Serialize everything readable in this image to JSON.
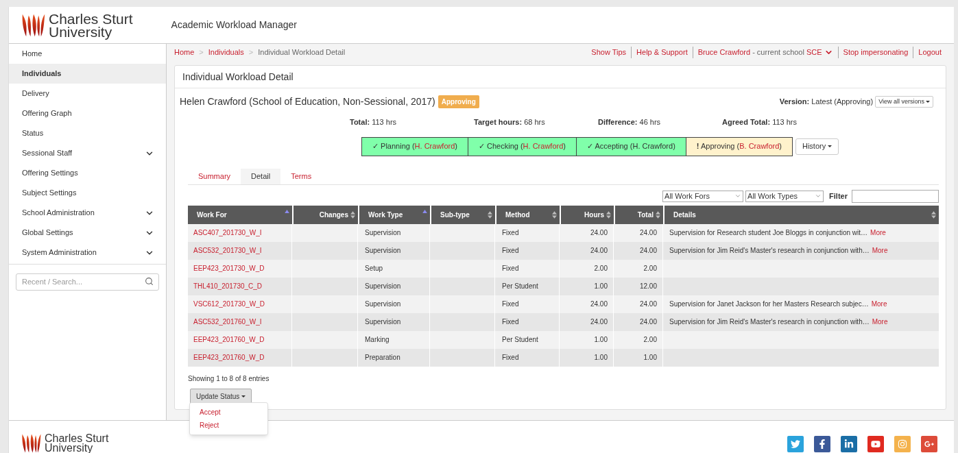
{
  "header": {
    "logo_lines": [
      "Charles Sturt",
      "University"
    ],
    "app_title": "Academic Workload Manager"
  },
  "sidebar": {
    "items": [
      {
        "label": "Home",
        "selected": false,
        "expandable": false
      },
      {
        "label": "Individuals",
        "selected": true,
        "expandable": false
      },
      {
        "label": "Delivery",
        "selected": false,
        "expandable": false
      },
      {
        "label": "Offering Graph",
        "selected": false,
        "expandable": false
      },
      {
        "label": "Status",
        "selected": false,
        "expandable": false
      },
      {
        "label": "Sessional Staff",
        "selected": false,
        "expandable": true
      },
      {
        "label": "Offering Settings",
        "selected": false,
        "expandable": false
      },
      {
        "label": "Subject Settings",
        "selected": false,
        "expandable": false
      },
      {
        "label": "School Administration",
        "selected": false,
        "expandable": true
      },
      {
        "label": "Global Settings",
        "selected": false,
        "expandable": true
      },
      {
        "label": "System Administration",
        "selected": false,
        "expandable": true
      }
    ],
    "search": {
      "placeholder": "Recent / Search..."
    }
  },
  "breadcrumb": [
    {
      "kind": "link",
      "label": "Home"
    },
    {
      "kind": "separator",
      "label": ">"
    },
    {
      "kind": "link",
      "label": "Individuals"
    },
    {
      "kind": "separator",
      "label": ">"
    },
    {
      "kind": "current",
      "label": "Individual Workload Detail"
    }
  ],
  "top_links": [
    {
      "kind": "link",
      "label": "Show Tips"
    },
    {
      "kind": "link",
      "label": "Help & Support"
    },
    {
      "kind": "user",
      "name": "Bruce Crawford",
      "note": "- current school",
      "school": "SCE"
    },
    {
      "kind": "link",
      "label": "Stop impersonating"
    },
    {
      "kind": "link",
      "label": "Logout"
    }
  ],
  "panel": {
    "title": "Individual Workload Detail",
    "person": "Helen Crawford (School of Education, Non-Sessional, 2017)",
    "status_badge": "Approving",
    "version": {
      "label": "Version:",
      "value": "Latest (Approving)",
      "button": "View all versions"
    },
    "totals": [
      {
        "label": "Total:",
        "value": "113 hrs"
      },
      {
        "label": "Target hours:",
        "value": "68 hrs"
      },
      {
        "label": "Difference:",
        "value": "46 hrs"
      },
      {
        "label": "Agreed Total:",
        "value": "113 hrs"
      }
    ],
    "steps": [
      {
        "kind": "done",
        "mark": "✓",
        "label": "Planning (",
        "person": "H. Crawford",
        "close": ")",
        "person_link": true
      },
      {
        "kind": "done",
        "mark": "✓",
        "label": "Checking (",
        "person": "H. Crawford",
        "close": ")",
        "person_link": true
      },
      {
        "kind": "done",
        "mark": "✓",
        "label": "Accepting (",
        "person": "H. Crawford",
        "close": ")",
        "person_link": false
      },
      {
        "kind": "pending",
        "mark": "!",
        "label": "Approving (",
        "person": "B. Crawford",
        "close": ")",
        "person_link": true
      }
    ],
    "history_button": "History",
    "tabs": [
      {
        "label": "Summary",
        "selected": false
      },
      {
        "label": "Detail",
        "selected": true
      },
      {
        "label": "Terms",
        "selected": false
      }
    ],
    "filters": {
      "work_for": "All Work Fors",
      "work_type": "All Work Types",
      "filter_label": "Filter"
    },
    "table": {
      "columns": [
        {
          "label": "Work For",
          "sorted": true
        },
        {
          "label": "Changes",
          "sorted": false
        },
        {
          "label": "Work Type",
          "sorted": true
        },
        {
          "label": "Sub-type",
          "sorted": false
        },
        {
          "label": "Method",
          "sorted": false
        },
        {
          "label": "Hours",
          "sorted": false
        },
        {
          "label": "Total",
          "sorted": false
        },
        {
          "label": "Details",
          "sorted": false
        }
      ],
      "rows": [
        {
          "work_for": "ASC407_201730_W_I",
          "work_type": "Supervision",
          "method": "Fixed",
          "hours": "24.00",
          "total": "24.00",
          "details": "Supervision for Research student Joe Bloggs in conjunction wit…",
          "more": "More"
        },
        {
          "work_for": "ASC532_201730_W_I",
          "work_type": "Supervision",
          "method": "Fixed",
          "hours": "24.00",
          "total": "24.00",
          "details": "Supervision for Jim Reid's Master's research in conjunction with…",
          "more": "More"
        },
        {
          "work_for": "EEP423_201730_W_D",
          "work_type": "Setup",
          "method": "Fixed",
          "hours": "2.00",
          "total": "2.00"
        },
        {
          "work_for": "THL410_201730_C_D",
          "work_type": "Supervision",
          "method": "Per Student",
          "hours": "1.00",
          "total": "12.00"
        },
        {
          "work_for": "VSC612_201730_W_D",
          "work_type": "Supervision",
          "method": "Fixed",
          "hours": "24.00",
          "total": "24.00",
          "details": "Supervision for Janet Jackson for her Masters Research subjec…",
          "more": "More"
        },
        {
          "work_for": "ASC532_201760_W_I",
          "work_type": "Supervision",
          "method": "Fixed",
          "hours": "24.00",
          "total": "24.00",
          "details": "Supervision for Jim Reid's Master's research in conjunction with…",
          "more": "More"
        },
        {
          "work_for": "EEP423_201760_W_D",
          "work_type": "Marking",
          "method": "Per Student",
          "hours": "1.00",
          "total": "2.00"
        },
        {
          "work_for": "EEP423_201760_W_D",
          "work_type": "Preparation",
          "method": "Fixed",
          "hours": "1.00",
          "total": "1.00"
        }
      ]
    },
    "entries_info": "Showing 1 to 8 of 8 entries",
    "update_button": "Update Status",
    "update_menu": [
      "Accept",
      "Reject"
    ]
  },
  "footer": {
    "logo_lines": [
      "Charles Sturt",
      "University"
    ],
    "social": [
      {
        "kind": "twitter"
      },
      {
        "kind": "facebook"
      },
      {
        "kind": "linkedin"
      },
      {
        "kind": "youtube"
      },
      {
        "kind": "instagram"
      },
      {
        "kind": "googleplus"
      }
    ]
  }
}
